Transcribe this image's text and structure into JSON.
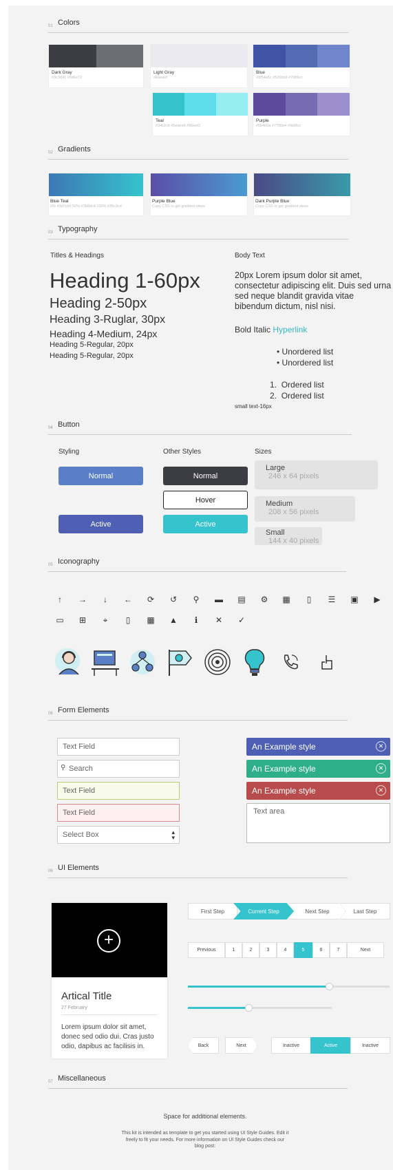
{
  "sections": {
    "colors": {
      "num": "01",
      "title": "Colors"
    },
    "gradients": {
      "num": "02",
      "title": "Gradients"
    },
    "typography": {
      "num": "03",
      "title": "Typography"
    },
    "button": {
      "num": "04",
      "title": "Button"
    },
    "iconography": {
      "num": "05",
      "title": "Iconography"
    },
    "forms": {
      "num": "06",
      "title": "Form Elements"
    },
    "ui": {
      "num": "06",
      "title": "UI Elements"
    },
    "misc": {
      "num": "07",
      "title": "Miscellaneous"
    }
  },
  "colors": [
    {
      "name": "Dark Gray",
      "hex": "#3c3d41 #6d6e72",
      "shades": [
        "#3c3d41",
        "#6d6e72"
      ]
    },
    {
      "name": "Light Gray",
      "hex": "#eaeaef",
      "shades": [
        "#eaeaef"
      ]
    },
    {
      "name": "Blue",
      "hex": "#3f54a5c #526bb3 #7086cc",
      "shades": [
        "#3f54a5",
        "#526bb3",
        "#7086cc"
      ]
    },
    {
      "name": "Teal",
      "hex": "#34c2cb #5edeeb #96eef2",
      "shades": [
        "#34c2cb",
        "#5edeeb",
        "#96eef2"
      ]
    },
    {
      "name": "Purple",
      "hex": "#5b4b9a #776bb4 #9b8fcc",
      "shades": [
        "#5b4b9a",
        "#776bb4",
        "#9b8fcc"
      ]
    }
  ],
  "gradients": [
    {
      "name": "Blue Teal",
      "hex": "0% #3d7cb5 50% #3b8dc4 100% #35c3cd",
      "from": "#3d78b4",
      "to": "#35c3cd"
    },
    {
      "name": "Purple Blue",
      "hex": "Copy CSS to get gradient steps",
      "from": "#5a4fa6",
      "to": "#4a9ad0"
    },
    {
      "name": "Dark Purple Blue",
      "hex": "Copy CSS to get gradient steps",
      "from": "#4a4a85",
      "to": "#3a9aaa"
    }
  ],
  "typography": {
    "titles_label": "Titles & Headings",
    "body_label": "Body Text",
    "h1": "Heading 1-60px",
    "h2": "Heading 2-50px",
    "h3": "Heading 3-Ruglar, 30px",
    "h4": "Heading 4-Medium, 24px",
    "h5a": "Heading 5-Regular, 20px",
    "h5b": "Heading 5-Regular, 20px",
    "body_text": "20px Lorem ipsum dolor sit amet, consectetur adipiscing elit. Duis sed urna sed neque blandit gravida vitae bibendum dictum, nisl nisi.",
    "bold_italic": "Bold Italic",
    "hyperlink": "Hyperlink",
    "ul": [
      "Unordered list",
      "Unordered list"
    ],
    "ol": [
      "Ordered list",
      "Ordered list"
    ],
    "small": "small text-16px"
  },
  "buttons": {
    "styling_label": "Styling",
    "other_label": "Other Styles",
    "sizes_label": "Sizes",
    "normal": "Normal",
    "hover": "Hover",
    "active": "Active",
    "large": "Large",
    "large_dim": "246 x 64 pixels",
    "medium": "Medium",
    "medium_dim": "208 x 56 pixels",
    "small": "Small",
    "small_dim": "144 x 40 pixels",
    "colors": {
      "blue": "#5a7fc7",
      "indigo": "#4f5fb3",
      "dark": "#3c3d41",
      "teal": "#35c3cd"
    }
  },
  "icons_row1": [
    "arrow-up-circle",
    "arrow-right-circle",
    "arrow-down-circle",
    "arrow-left-circle",
    "refresh",
    "undo",
    "search",
    "folder",
    "document",
    "settings",
    "table",
    "trash",
    "list",
    "image",
    "video"
  ],
  "icons_row2": [
    "laptop",
    "cart",
    "location",
    "mobile",
    "grid",
    "warning",
    "info",
    "close-circle",
    "check-circle"
  ],
  "icon_glyphs_row1": [
    "↑",
    "→",
    "↓",
    "←",
    "⟳",
    "↺",
    "⚲",
    "▬",
    "▤",
    "⚙",
    "▦",
    "▯",
    "☰",
    "▣",
    "▶"
  ],
  "icon_glyphs_row2": [
    "▭",
    "⊞",
    "⌖",
    "▯",
    "▦",
    "▲",
    "ℹ",
    "✕",
    "✓"
  ],
  "forms": {
    "text_field": "Text Field",
    "search": "Search",
    "text_field_ok": "Text Field",
    "text_field_err": "Text Field",
    "select": "Select Box",
    "alert": "An Example style",
    "textarea": "Text area"
  },
  "ui": {
    "steps": [
      "First Step",
      "Current Step",
      "Next Step",
      "Last Step"
    ],
    "pages": [
      "Previous",
      "1",
      "2",
      "3",
      "4",
      "5",
      "6",
      "7",
      "Next"
    ],
    "active_page": "5",
    "slider1": 0.7,
    "slider2": 0.42,
    "card_title": "Artical Title",
    "card_date": "27 February",
    "card_body": "Lorem ipsum dolor sit amet, donec sed odio dui. Cras justo odio, dapibus ac facilisis in.",
    "back": "Back",
    "next": "Next",
    "toggles": [
      "Inactive",
      "Active",
      "Inactive"
    ]
  },
  "misc": {
    "space": "Space for additional elements.",
    "note": "This kit is intended as template to get you started using UI Style Guides. Edit it freely to fit your needs. For more information on UI Style Guides check our blog post:"
  }
}
